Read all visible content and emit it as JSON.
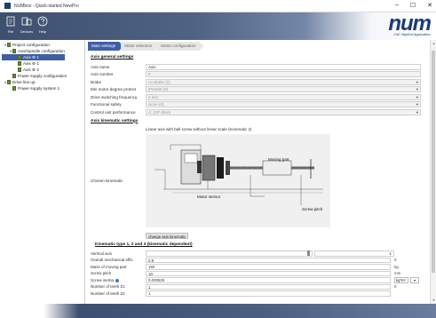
{
  "window": {
    "title": "NUMbox - Quick-started NewPro",
    "minimize": "–",
    "maximize": "☐",
    "close": "✕"
  },
  "toolbar": {
    "file": "File",
    "devices": "Devices",
    "help": "Help"
  },
  "logo": {
    "word": "num",
    "tagline": "CNC HighEnd Applications",
    "brand_color": "#1b3a7a"
  },
  "tree": [
    {
      "label": "Project configuration",
      "toggle": "▾"
    },
    {
      "label": "Axis/Spindle configuration",
      "toggle": "▾"
    },
    {
      "label": "Axis ⚙ 1"
    },
    {
      "label": "Axis ⚙ 1"
    },
    {
      "label": "Axis ⚙ 2"
    },
    {
      "label": "Power supply configuration"
    },
    {
      "label": "Drive line up",
      "toggle": "▾"
    },
    {
      "label": "Power supply system 1"
    }
  ],
  "tabs": [
    "Main settings",
    "Motor selection",
    "Motor configuration"
  ],
  "general": {
    "heading": "Axis general settings",
    "rows": [
      {
        "label": "Axis name",
        "value": "Axis"
      },
      {
        "label": "Axis number",
        "value": "0"
      },
      {
        "label": "Brake",
        "value": "no Brake (0)"
      },
      {
        "label": "Min motor degree protect",
        "value": "IP54/60 (0)"
      },
      {
        "label": "Drive switching frequency",
        "value": "5 kHz"
      },
      {
        "label": "Functional safety",
        "value": "None (0)"
      },
      {
        "label": "Control unit performance",
        "value": "A: (SP drive)"
      }
    ]
  },
  "kinematic": {
    "heading": "Axis kinematic settings",
    "label": "Chosen kinematic",
    "description": "Linear axis with ball screw without linear scale (Kinematic 2)",
    "moving_part": "Moving part",
    "motor_sensor": "Motor sensor",
    "screw_pitch": "Screw pitch",
    "change_button": "change axis kinematic"
  },
  "dependent": {
    "heading": "Kinematic type 1, 2 and 3 (kinematic dependent)",
    "rows": [
      {
        "label": "Vertical axis",
        "value": "",
        "unit": "1"
      },
      {
        "label": "Overall mechanical effic.",
        "value": "0.9",
        "unit": "0"
      },
      {
        "label": "Mass of moving part",
        "value": "150",
        "unit": "kg"
      },
      {
        "label": "Screw pitch",
        "value": "10",
        "unit": "mm"
      },
      {
        "label": "Screw inertia",
        "value": "0.000525",
        "unit": "kg*m²"
      },
      {
        "label": "Number of teeth Z1",
        "value": "1",
        "unit": "0"
      },
      {
        "label": "Number of teeth Z2",
        "value": "1",
        "unit": ""
      }
    ]
  }
}
